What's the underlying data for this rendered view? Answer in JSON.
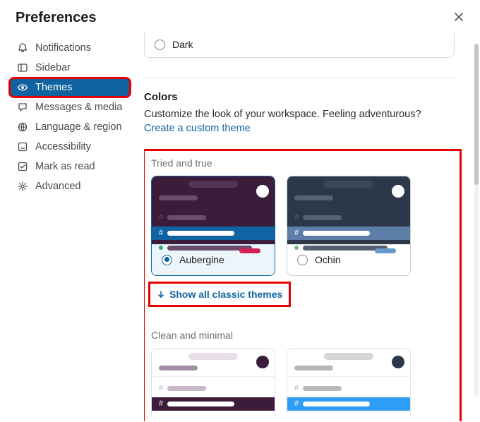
{
  "header": {
    "title": "Preferences"
  },
  "sidebar": {
    "items": [
      {
        "label": "Notifications",
        "icon": "bell-icon"
      },
      {
        "label": "Sidebar",
        "icon": "panel-icon"
      },
      {
        "label": "Themes",
        "icon": "eye-icon"
      },
      {
        "label": "Messages & media",
        "icon": "chat-icon"
      },
      {
        "label": "Language & region",
        "icon": "globe-icon"
      },
      {
        "label": "Accessibility",
        "icon": "accessibility-icon"
      },
      {
        "label": "Mark as read",
        "icon": "check-icon"
      },
      {
        "label": "Advanced",
        "icon": "gear-icon"
      }
    ],
    "active_index": 2
  },
  "appearance": {
    "dark_mode_label": "Dark"
  },
  "colors": {
    "section_title": "Colors",
    "desc": "Customize the look of your workspace. Feeling adventurous?",
    "create_link": "Create a custom theme",
    "group1_label": "Tried and true",
    "themes": {
      "aubergine": {
        "label": "Aubergine",
        "selected": true
      },
      "ochin": {
        "label": "Ochin",
        "selected": false
      }
    },
    "show_all": "Show all classic themes",
    "group2_label": "Clean and minimal"
  },
  "palettes": {
    "aubergine": {
      "top": "#3b1d3b",
      "title": "#553555",
      "body": "#3b1d3b",
      "line": "#6b4c6b",
      "hilite": "#1164a3",
      "hilite_text": "#ffffff",
      "presence": "#2bac76",
      "badge": "#d1235a"
    },
    "ochin": {
      "top": "#2c3849",
      "title": "#3a475a",
      "body": "#2c3849",
      "line": "#556172",
      "hilite": "#5c7ea8",
      "hilite_text": "#ffffff",
      "presence": "#7fb882",
      "badge": "#6698c8"
    },
    "clean_a": {
      "top": "#ffffff",
      "title": "#e8dce8",
      "body": "#ffffff",
      "line": "#c9b8c9",
      "line2": "#a88da8",
      "hilite": "#3b1d3b",
      "presence": "#5aa05a",
      "badge": "#d1235a",
      "avatar": "#3b1d3b"
    },
    "clean_b": {
      "top": "#ffffff",
      "title": "#d6d6d6",
      "body": "#ffffff",
      "line": "#b8b8b8",
      "hilite": "#2e9df7",
      "presence": "#5aa05a",
      "badge": "#d1235a",
      "avatar": "#2c3849"
    }
  }
}
